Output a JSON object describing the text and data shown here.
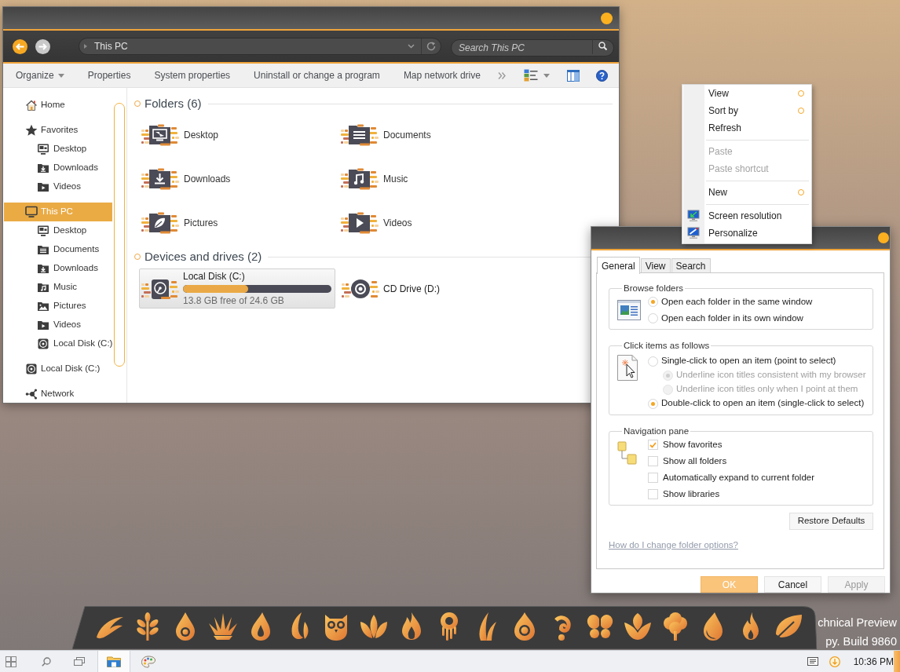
{
  "explorer": {
    "back": {
      "disabled": false
    },
    "forward": {
      "disabled": true
    },
    "address": {
      "crumbs": [
        "This PC"
      ]
    },
    "search": {
      "placeholder": "Search This PC"
    },
    "toolbar": [
      {
        "label": "Organize",
        "kind": "menu"
      },
      {
        "label": "Properties",
        "kind": "command"
      },
      {
        "label": "System properties",
        "kind": "command"
      },
      {
        "label": "Uninstall or change a program",
        "kind": "command"
      },
      {
        "label": "Map network drive",
        "kind": "command"
      }
    ],
    "sidebar": [
      {
        "label": "Home",
        "kind": "home",
        "selected": false
      },
      {
        "label": "Favorites",
        "kind": "star",
        "selected": false,
        "children": [
          {
            "label": "Desktop",
            "kind": "desktop",
            "selected": false
          },
          {
            "label": "Downloads",
            "kind": "downloads",
            "selected": false
          },
          {
            "label": "Videos",
            "kind": "videos",
            "selected": false
          }
        ]
      },
      {
        "label": "This PC",
        "kind": "pc",
        "selected": true,
        "children": [
          {
            "label": "Desktop",
            "kind": "desktop",
            "selected": false
          },
          {
            "label": "Documents",
            "kind": "documents",
            "selected": false
          },
          {
            "label": "Downloads",
            "kind": "downloads",
            "selected": false
          },
          {
            "label": "Music",
            "kind": "music",
            "selected": false
          },
          {
            "label": "Pictures",
            "kind": "pictures",
            "selected": false
          },
          {
            "label": "Videos",
            "kind": "videos",
            "selected": false
          },
          {
            "label": "Local Disk (C:)",
            "kind": "disk",
            "selected": false
          }
        ]
      },
      {
        "label": "Local Disk (C:)",
        "kind": "disk",
        "selected": false
      },
      {
        "label": "Network",
        "kind": "network",
        "selected": false
      }
    ],
    "sections": [
      {
        "title": "Folders (6)",
        "kind": "folders",
        "items": [
          {
            "label": "Desktop",
            "kind": "desktop"
          },
          {
            "label": "Documents",
            "kind": "documents"
          },
          {
            "label": "Downloads",
            "kind": "downloads"
          },
          {
            "label": "Music",
            "kind": "music"
          },
          {
            "label": "Pictures",
            "kind": "pictures"
          },
          {
            "label": "Videos",
            "kind": "videos"
          }
        ]
      },
      {
        "title": "Devices and drives (2)",
        "kind": "drives",
        "items": [
          {
            "label": "Local Disk (C:)",
            "kind": "disk",
            "selected": true,
            "level": 0.44,
            "detail": "13.8 GB free of 24.6 GB"
          },
          {
            "label": "CD Drive (D:)",
            "kind": "cd",
            "selected": false
          }
        ]
      }
    ]
  },
  "context_menu": {
    "groups": [
      [
        {
          "label": "View",
          "kind": "plain",
          "submenu": true,
          "disabled": false
        },
        {
          "label": "Sort by",
          "kind": "plain",
          "submenu": true,
          "disabled": false
        },
        {
          "label": "Refresh",
          "kind": "plain",
          "submenu": false,
          "disabled": false
        }
      ],
      [
        {
          "label": "Paste",
          "kind": "plain",
          "submenu": false,
          "disabled": true
        },
        {
          "label": "Paste shortcut",
          "kind": "plain",
          "submenu": false,
          "disabled": true
        }
      ],
      [
        {
          "label": "New",
          "kind": "plain",
          "submenu": true,
          "disabled": false
        }
      ],
      [
        {
          "label": "Screen resolution",
          "kind": "resolution",
          "submenu": false,
          "disabled": false
        },
        {
          "label": "Personalize",
          "kind": "personalize",
          "submenu": false,
          "disabled": false
        }
      ]
    ]
  },
  "folder_options": {
    "tabs": [
      {
        "label": "General",
        "selected": true
      },
      {
        "label": "View",
        "selected": false
      },
      {
        "label": "Search",
        "selected": false
      }
    ],
    "groups": [
      {
        "title": "Browse folders",
        "kind": "radio",
        "options": [
          {
            "label": "Open each folder in the same window",
            "selected": true,
            "disabled": false
          },
          {
            "label": "Open each folder in its own window",
            "selected": false,
            "disabled": false
          }
        ]
      },
      {
        "title": "Click items as follows",
        "kind": "radio",
        "options": [
          {
            "label": "Single-click to open an item (point to select)",
            "selected": false,
            "disabled": false,
            "children": [
              {
                "label": "Underline icon titles consistent with my browser",
                "selected": true,
                "disabled": true
              },
              {
                "label": "Underline icon titles only when I point at them",
                "selected": false,
                "disabled": true
              }
            ]
          },
          {
            "label": "Double-click to open an item (single-click to select)",
            "selected": true,
            "disabled": false
          }
        ]
      },
      {
        "title": "Navigation pane",
        "kind": "checkbox",
        "options": [
          {
            "label": "Show favorites",
            "checked": true
          },
          {
            "label": "Show all folders",
            "checked": false
          },
          {
            "label": "Automatically expand to current folder",
            "checked": false
          },
          {
            "label": "Show libraries",
            "checked": false
          }
        ]
      }
    ],
    "restore_button": "Restore Defaults",
    "help_link": "How do I change folder options?",
    "buttons": [
      {
        "label": "OK",
        "default": true,
        "disabled": false
      },
      {
        "label": "Cancel",
        "default": false,
        "disabled": false
      },
      {
        "label": "Apply",
        "default": false,
        "disabled": true
      }
    ]
  },
  "desktop_text": [
    "chnical Preview",
    "py. Build 9860"
  ],
  "taskbar": {
    "apps": [
      {
        "kind": "explorer",
        "active": true
      },
      {
        "kind": "paint",
        "active": false
      }
    ],
    "clock": "10:36 PM"
  }
}
